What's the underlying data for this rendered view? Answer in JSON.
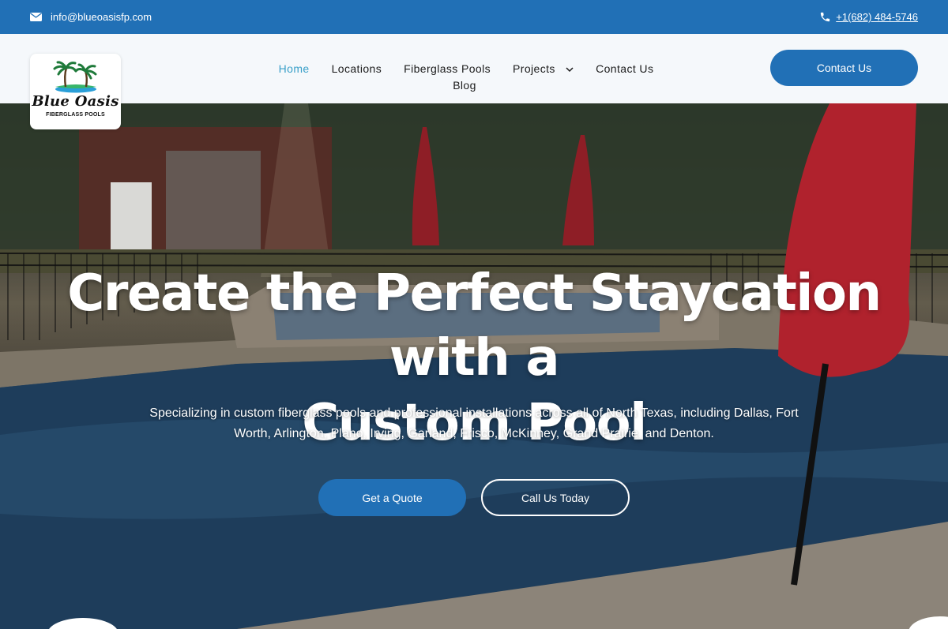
{
  "topbar": {
    "email": "info@blueoasisfp.com",
    "phone": "+1(682) 484-5746",
    "email_icon": "envelope-icon",
    "phone_icon": "phone-icon"
  },
  "logo": {
    "name": "Blue Oasis",
    "tagline": "FIBERGLASS POOLS"
  },
  "nav": {
    "items": [
      {
        "label": "Home",
        "active": true
      },
      {
        "label": "Locations"
      },
      {
        "label": "Fiberglass Pools"
      },
      {
        "label": "Projects",
        "has_dropdown": true
      },
      {
        "label": "Contact Us"
      },
      {
        "label": "Blog"
      }
    ]
  },
  "header": {
    "cta_label": "Contact Us"
  },
  "hero": {
    "title_line1": "Create the Perfect Staycation with a",
    "title_line2": "Custom Pool",
    "subtitle": "Specializing in custom fiberglass pools and professional installations across all of North Texas, including Dallas, Fort Worth, Arlington, Plano, Irving, Garland, Frisco, McKinney, Grand Prairie, and Denton.",
    "primary_button": "Get a Quote",
    "secondary_button": "Call Us Today"
  },
  "colors": {
    "brand_blue": "#2170b6",
    "nav_active": "#3aa0c9",
    "header_bg": "#f5f8fb"
  }
}
